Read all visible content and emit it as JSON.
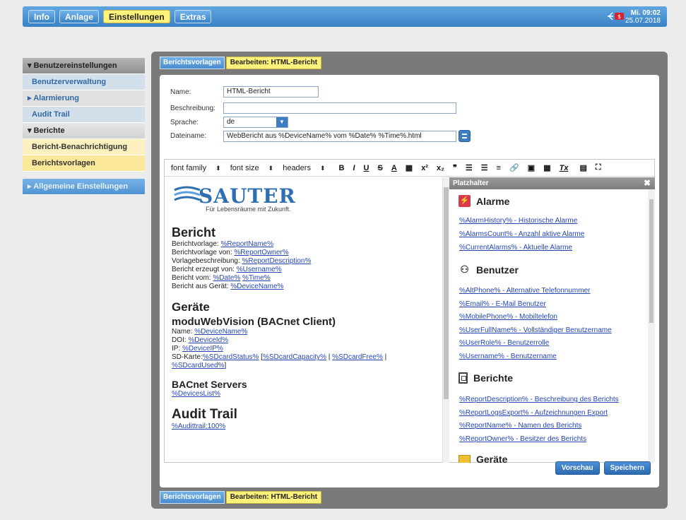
{
  "topnav": {
    "items": [
      "Info",
      "Anlage",
      "Einstellungen",
      "Extras"
    ],
    "active": "Einstellungen"
  },
  "clock": {
    "time": "Mi. 09:02",
    "date": "25.07.2018"
  },
  "sidebar": {
    "benutzer_head": "Benutzereinstellungen",
    "benutzerverwaltung": "Benutzerverwaltung",
    "alarmierung": "Alarmierung",
    "audit_trail": "Audit Trail",
    "berichte": "Berichte",
    "bericht_benachrichtigung": "Bericht-Benachrichtigung",
    "berichtsvorlagen": "Berichtsvorlagen",
    "allgemeine": "Allgemeine Einstellungen",
    "collapsed_marker": "▸",
    "expanded_marker": "▾"
  },
  "breadcrumb": {
    "first": "Berichtsvorlagen",
    "second": "Bearbeiten: HTML-Bericht"
  },
  "form": {
    "name_label": "Name:",
    "name_value": "HTML-Bericht",
    "desc_label": "Beschreibung:",
    "desc_value": "",
    "lang_label": "Sprache:",
    "lang_value": "de",
    "file_label": "Dateiname:",
    "file_value": "WebBericht aus %DeviceName% vom %Date% %Time%.html"
  },
  "toolbar": {
    "font_family": "font family",
    "font_size": "font size",
    "headers": "headers",
    "caret": "⬍",
    "bold": "B",
    "italic": "I",
    "underline": "U",
    "strike": "S",
    "color": "A",
    "highlight": "▦",
    "sup": "x²",
    "sub": "x₂",
    "quote": "❞",
    "ul": "☰",
    "ol": "☰",
    "align": "≡",
    "link": "🔗",
    "image": "▣",
    "table": "▦",
    "clear": "Tx",
    "source": "▤",
    "fullscreen": "⛶"
  },
  "document": {
    "logo": "SAUTER",
    "tagline": "Für Lebensräume mit Zukunft.",
    "bericht_heading": "Bericht",
    "lines": [
      {
        "label": "Berichtvorlage: ",
        "link": "%ReportName%"
      },
      {
        "label": "Berichtvorlage von: ",
        "link": "%ReportOwner%"
      },
      {
        "label": "Vorlagebeschreibung: ",
        "link": "%ReportDescription%"
      },
      {
        "label": "Bericht erzeugt von: ",
        "link": "%Username%"
      }
    ],
    "vom_label": "Bericht vom: ",
    "vom_date": "%Date%",
    "vom_time": "%Time%",
    "geraet_label": "Bericht aus Gerät: ",
    "geraet_link": "%DeviceName%",
    "geraete_heading": "Geräte",
    "device_heading": "moduWebVision (BACnet Client)",
    "name_label": "Name: ",
    "name_link": "%DeviceName%",
    "doi_label": "DOI: ",
    "doi_link": "%DeviceId%",
    "ip_label": "IP: ",
    "ip_link": "%DeviceIP%",
    "sd_label": "SD-Karte:",
    "sd_status": "%SDcardStatus%",
    "sd_open": " [",
    "sd_capacity": "%SDcardCapacity%",
    "sd_sep1": " | ",
    "sd_free": "%SDcardFree%",
    "sd_sep2": " |",
    "sd_used": "%SDcardUsed%",
    "sd_close": "]",
    "bacnet_heading": "BACnet Servers",
    "devices_list": "%DevicesList%",
    "audit_heading": "Audit Trail",
    "audit_link": "%Audittrail;100%"
  },
  "placeholders": {
    "title": "Platzhalter",
    "close": "✖",
    "alarme_title": "Alarme",
    "alarme_icon_glyph": "⚡",
    "alarme": [
      "%AlarmHistory% - Historische Alarme",
      "%AlarmsCount% - Anzahl aktive Alarme",
      "%CurrentAlarms% - Aktuelle Alarme"
    ],
    "benutzer_title": "Benutzer",
    "benutzer_icon_glyph": "⚇",
    "benutzer": [
      "%AltPhone% - Alternative Telefonnummer",
      "%Email% - E-Mail Benutzer",
      "%MobilePhone% - Mobiltelefon",
      "%UserFullName% - Vollständiger Benutzername",
      "%UserRole% - Benutzerrolle",
      "%Username% - Benutzername"
    ],
    "berichte_title": "Berichte",
    "berichte": [
      "%ReportDescription% - Beschreibung des Berichts",
      "%ReportLogsExport% - Aufzeichnungen Export",
      "%ReportName% - Namen des Berichts",
      "%ReportOwner% - Besitzer des Berichts"
    ],
    "geraete_title": "Geräte"
  },
  "actions": {
    "preview": "Vorschau",
    "save": "Speichern"
  }
}
